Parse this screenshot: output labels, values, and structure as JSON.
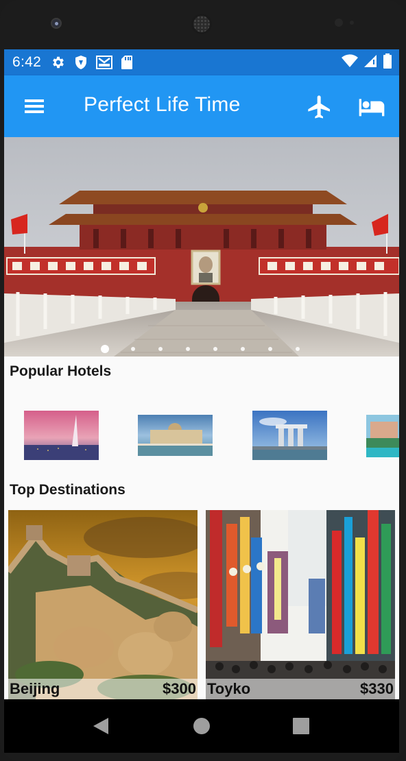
{
  "status_bar": {
    "time": "6:42",
    "left_icons": [
      "gear-icon",
      "shield-icon",
      "gmail-icon",
      "sd-card-icon"
    ],
    "right_icons": [
      "wifi-icon",
      "signal-icon",
      "battery-icon"
    ]
  },
  "app_bar": {
    "title": "Perfect Life Time",
    "actions": [
      "flight-icon",
      "hotel-bed-icon"
    ],
    "color": "#2196f3",
    "status_color": "#1976d2"
  },
  "carousel": {
    "slide_count": 8,
    "active_index": 0
  },
  "sections": {
    "popular_hotels": "Popular Hotels",
    "top_destinations": "Top Destinations"
  },
  "destinations": [
    {
      "name": "Beijing",
      "price": "$300"
    },
    {
      "name": "Toyko",
      "price": "$330"
    }
  ],
  "nav_bar": {
    "buttons": [
      "back-icon",
      "home-icon",
      "recents-icon"
    ]
  }
}
